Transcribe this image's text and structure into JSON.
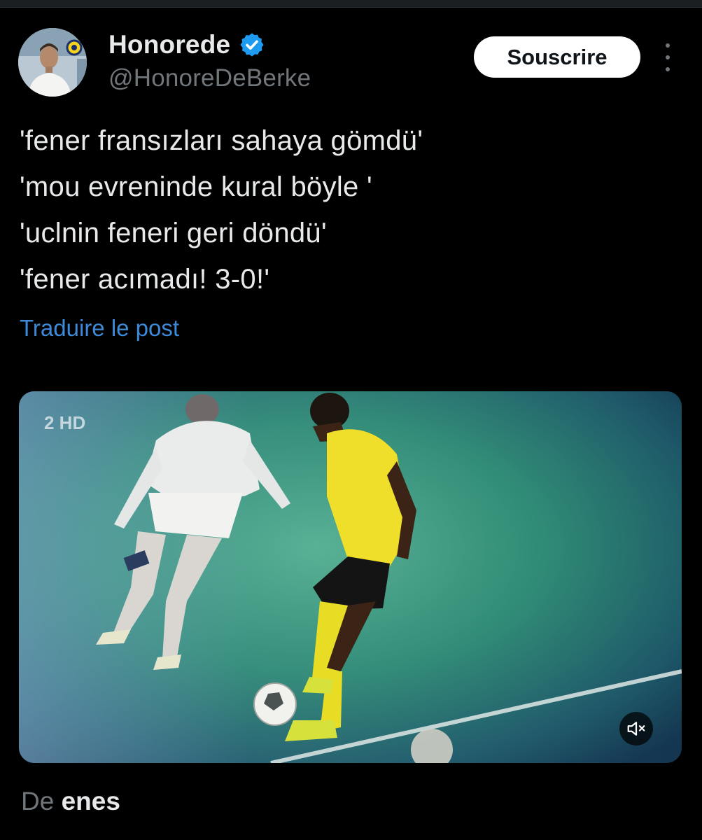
{
  "tweet": {
    "author": {
      "display_name": "Honorede",
      "handle": "@HonoreDeBerke",
      "verified": true,
      "avatar_icon": "profile-photo"
    },
    "subscribe_label": "Souscrire",
    "more_icon": "more-vertical-icon",
    "text_lines": [
      "'fener fransızları sahaya gömdü'",
      "'mou evreninde kural böyle '",
      "'uclnin feneri geri döndü'",
      "'fener acımadı! 3-0!'"
    ],
    "translate_label": "Traduire le post",
    "media": {
      "type": "video",
      "broadcaster_logo": "2 HD",
      "mute_icon": "volume-muted-icon"
    },
    "from": {
      "prefix": "De",
      "user": "enes"
    }
  },
  "colors": {
    "background": "#000000",
    "text_primary": "#e7e9ea",
    "text_secondary": "#71767b",
    "link": "#3d8ad8",
    "verified_badge": "#1d9bf0",
    "button_bg": "#ffffff"
  }
}
